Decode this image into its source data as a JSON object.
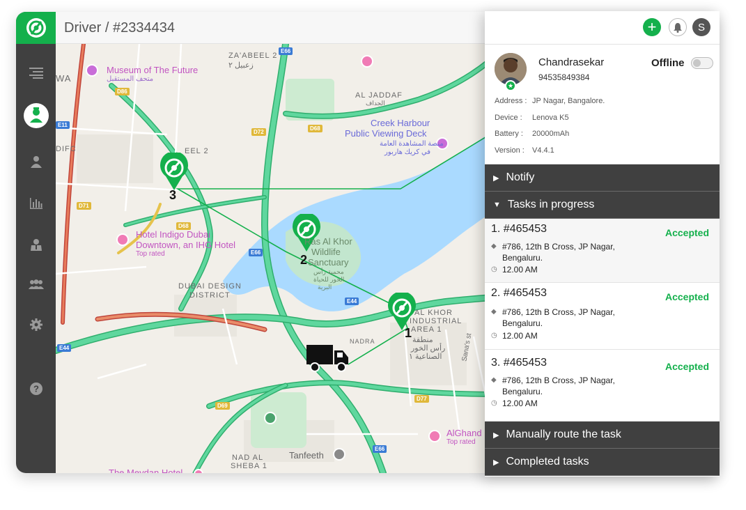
{
  "header": {
    "title": "Driver / #2334434"
  },
  "sidebar": {
    "logo_icon": "target-icon",
    "items": [
      {
        "icon": "menu-icon"
      },
      {
        "icon": "driver-icon",
        "active": true
      },
      {
        "icon": "user-icon"
      },
      {
        "icon": "bar-chart-icon"
      },
      {
        "icon": "agent-icon"
      },
      {
        "icon": "team-icon"
      },
      {
        "icon": "gear-icon"
      },
      {
        "icon": "help-icon"
      }
    ]
  },
  "map": {
    "labels": {
      "zaabeel": "ZA'ABEEL 2",
      "zaabeel_ar": "زعبيل ٢",
      "wa": "WA",
      "museum": "Museum of The Future",
      "museum_ar": "متحف المستقبل",
      "jaddaf": "AL JADDAF",
      "jaddaf_ar": "الجداف",
      "creek1": "Creek Harbour",
      "creek2": "Public Viewing Deck",
      "creek_ar1": "منصة المشاهدة العامة",
      "creek_ar2": "في كريك هاربور",
      "difc": "DIFC",
      "eel2": "EEL 2",
      "hotel1": "Hotel Indigo Dubai",
      "hotel2": "Downtown, an IHG Hotel",
      "top_rated1": "Top rated",
      "ras1": "Ras Al Khor",
      "ras2": "Wildlife",
      "ras3": "Sanctuary",
      "ras_ar1": "محمية رأس",
      "ras_ar2": "الخور للحياة",
      "ras_ar3": "البرية",
      "ddd1": "DUBAI DESIGN",
      "ddd2": "DISTRICT",
      "rki1": "AL KHOR",
      "rki2": "INDUSTRIAL",
      "rki3": "AREA 1",
      "rki_ar1": "منطقة",
      "rki_ar2": "رأس الخور",
      "rki_ar3": "الصناعية ١",
      "nadra": "NADRA",
      "sanna": "Sana's st",
      "alghand": "AlGhand",
      "top_rated2": "Top rated",
      "tanfeeth": "Tanfeeth",
      "nadalsheba1": "NAD AL",
      "nadalsheba2": "SHEBA 1",
      "meydan": "The Meydan Hotel"
    },
    "roads": {
      "e66a": "E66",
      "d86": "D86",
      "e11": "E11",
      "d72": "D72",
      "d68a": "D68",
      "d71": "D71",
      "d68b": "D68",
      "e66b": "E66",
      "e44a": "E44",
      "e44b": "E44",
      "d69": "D69",
      "d77": "D77",
      "e66c": "E66"
    },
    "stops": [
      "1",
      "2",
      "3"
    ]
  },
  "panel": {
    "add_label": "+",
    "avatar_letter": "S",
    "driver": {
      "name": "Chandrasekar",
      "phone": "94535849384",
      "status_label": "Offline",
      "online": false
    },
    "info": [
      {
        "key": "Address :",
        "value": "JP Nagar, Bangalore."
      },
      {
        "key": "Device :",
        "value": "Lenova K5"
      },
      {
        "key": "Battery :",
        "value": "20000mAh"
      },
      {
        "key": "Version :",
        "value": "V4.4.1"
      }
    ],
    "sections": {
      "notify": "Notify",
      "in_progress": "Tasks in progress",
      "manual": "Manually route the task",
      "completed": "Completed tasks"
    },
    "tasks": [
      {
        "id": "1. #465453",
        "status": "Accepted",
        "address": "#786, 12th B Cross, JP Nagar, Bengaluru.",
        "time": "12.00 AM"
      },
      {
        "id": "2. #465453",
        "status": "Accepted",
        "address": "#786, 12th B Cross, JP Nagar, Bengaluru.",
        "time": "12.00 AM"
      },
      {
        "id": "3. #465453",
        "status": "Accepted",
        "address": "#786, 12th B Cross, JP Nagar, Bengaluru.",
        "time": "12.00 AM"
      }
    ]
  },
  "colors": {
    "brand": "#14b04c",
    "sidebar": "#404040",
    "water": "#aadaff",
    "road": "#5fd79e",
    "road_edge": "#2fae6d"
  }
}
